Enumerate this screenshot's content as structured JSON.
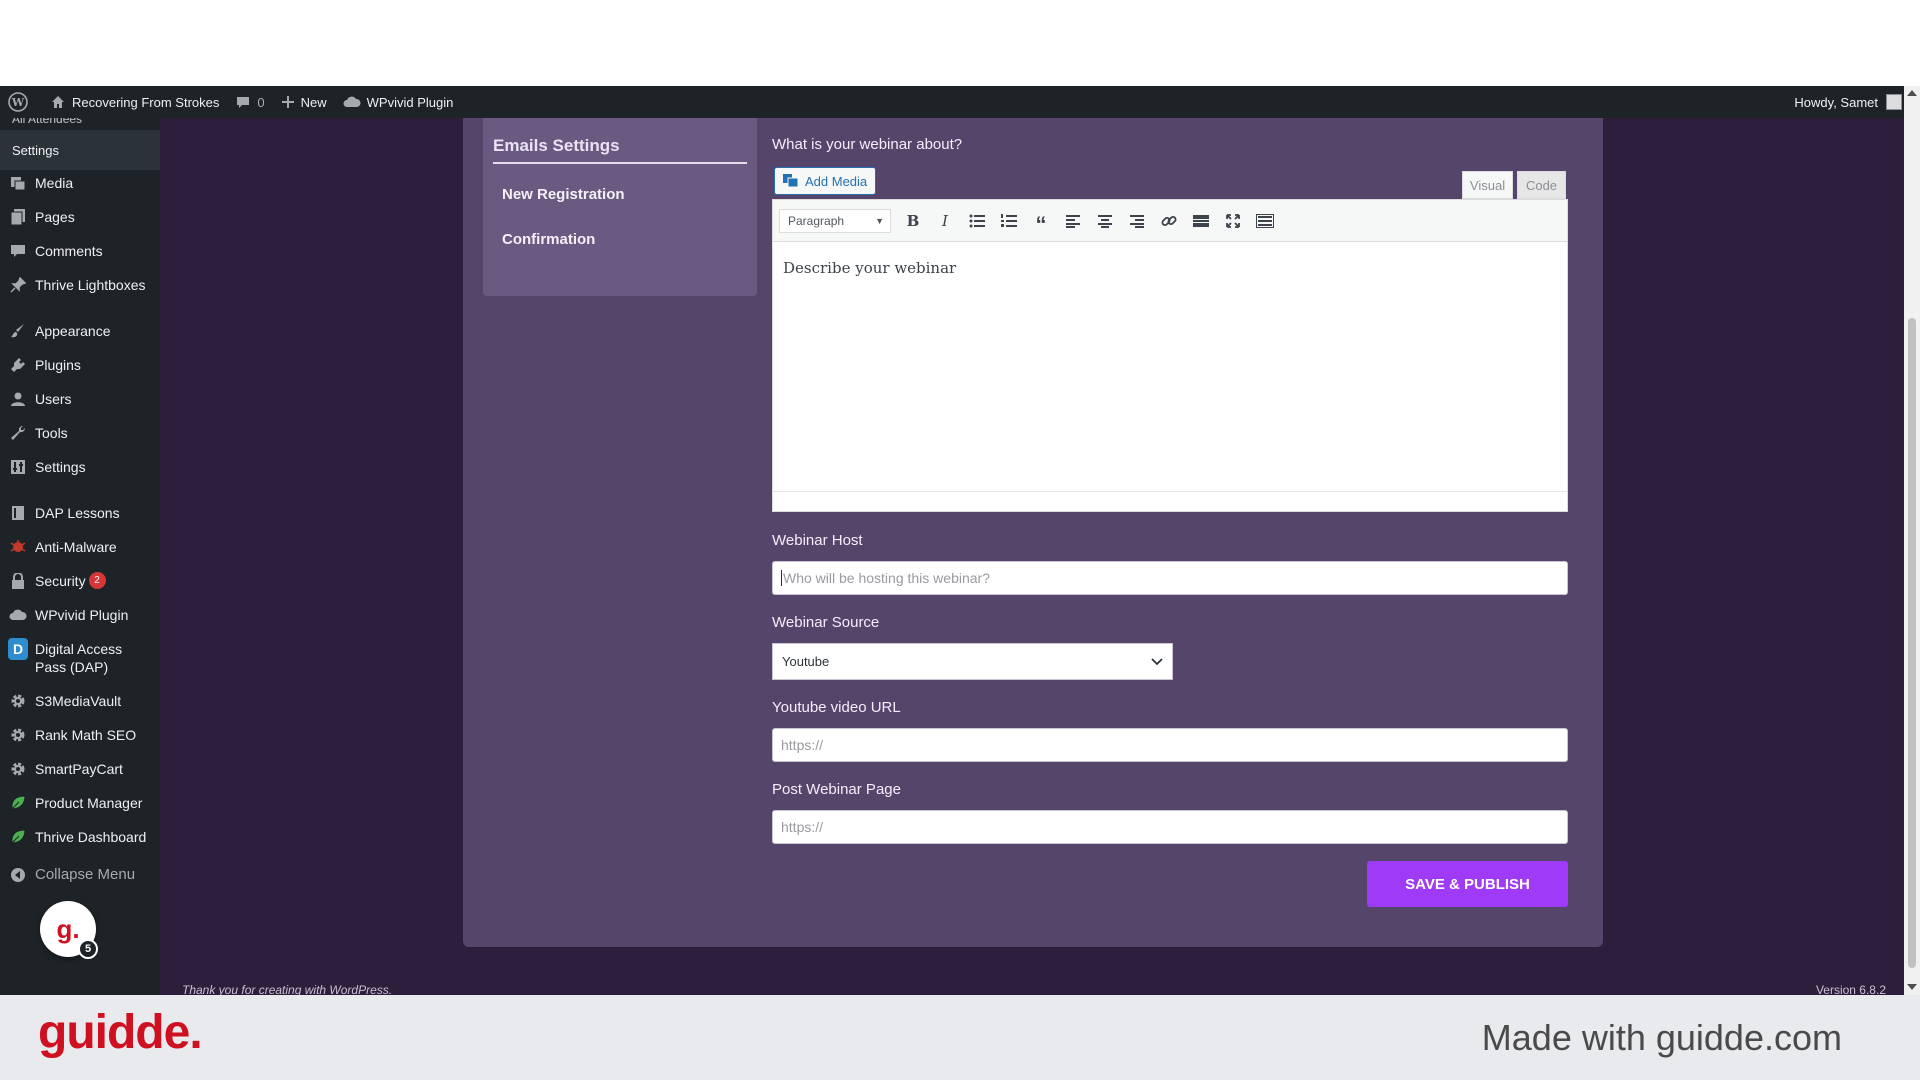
{
  "admin_bar": {
    "site_name": "Recovering From Strokes",
    "comments_count": "0",
    "new_label": "New",
    "plugin_label": "WPvivid Plugin",
    "greeting": "Howdy, Samet"
  },
  "sidebar": {
    "cut_submenu": "All Attendees",
    "current_submenu": "Settings",
    "items": [
      {
        "label": "Media",
        "icon": "media-icon"
      },
      {
        "label": "Pages",
        "icon": "pages-icon"
      },
      {
        "label": "Comments",
        "icon": "comments-icon"
      },
      {
        "label": "Thrive Lightboxes",
        "icon": "pin-icon"
      },
      {
        "label": "Appearance",
        "icon": "brush-icon"
      },
      {
        "label": "Plugins",
        "icon": "plugin-icon"
      },
      {
        "label": "Users",
        "icon": "user-icon"
      },
      {
        "label": "Tools",
        "icon": "wrench-icon"
      },
      {
        "label": "Settings",
        "icon": "settings-icon"
      },
      {
        "label": "DAP Lessons",
        "icon": "book-icon"
      },
      {
        "label": "Anti-Malware",
        "icon": "bug-icon"
      },
      {
        "label": "Security",
        "icon": "lock-icon",
        "badge": "2"
      },
      {
        "label": "WPvivid Plugin",
        "icon": "cloud-icon"
      },
      {
        "label": "Digital Access Pass (DAP)",
        "icon": "dap-icon",
        "icon_text": "D"
      },
      {
        "label": "S3MediaVault",
        "icon": "gear-icon"
      },
      {
        "label": "Rank Math SEO",
        "icon": "gear-icon"
      },
      {
        "label": "SmartPayCart",
        "icon": "gear-icon"
      },
      {
        "label": "Product Manager",
        "icon": "leaf-icon"
      },
      {
        "label": "Thrive Dashboard",
        "icon": "leaf-icon"
      }
    ],
    "collapse_label": "Collapse Menu",
    "guidde_bubble": {
      "letter": "g.",
      "count": "5"
    }
  },
  "emails_card": {
    "title": "Emails Settings",
    "links": [
      "New Registration",
      "Confirmation"
    ]
  },
  "form": {
    "about_label": "What is your webinar about?",
    "add_media_label": "Add Media",
    "tab_visual": "Visual",
    "tab_code": "Code",
    "format_select": "Paragraph",
    "editor_content": "Describe your webinar",
    "host_label": "Webinar Host",
    "host_placeholder": "Who will be hosting this webinar?",
    "source_label": "Webinar Source",
    "source_value": "Youtube",
    "youtube_label": "Youtube video URL",
    "youtube_placeholder": "https://",
    "post_label": "Post Webinar Page",
    "post_placeholder": "https://",
    "save_label": "SAVE & PUBLISH"
  },
  "footer": {
    "thanks": "Thank you for creating with WordPress.",
    "version": "Version 6.8.2"
  },
  "branding": {
    "logo": "guidde.",
    "made_with": "Made with guidde.com"
  },
  "colors": {
    "admin_bar": "#1d2327",
    "main_bg": "#2d1f3c",
    "panel_bg": "#56456b",
    "accent_button": "#9f3bf7",
    "guidde_red": "#cf1020"
  }
}
